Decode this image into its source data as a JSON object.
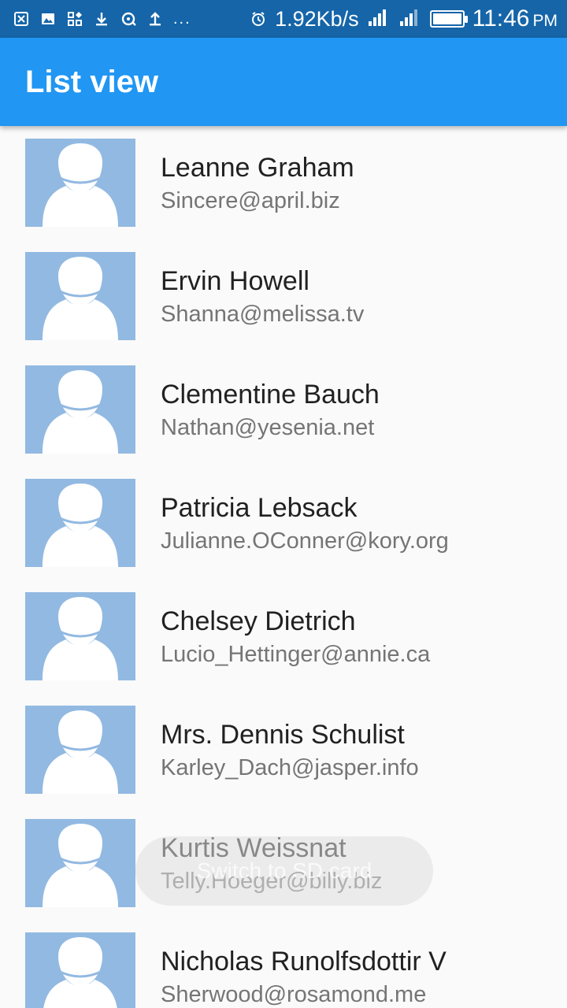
{
  "status_bar": {
    "notification_icons": [
      "close-box-icon",
      "image-icon",
      "apps-icon",
      "download-icon",
      "sync-icon",
      "upload-icon"
    ],
    "more": "...",
    "network_speed": "1.92Kb/s",
    "time": "11:46",
    "ampm": "PM"
  },
  "app_bar": {
    "title": "List view",
    "color": "#2196f3"
  },
  "contacts": [
    {
      "name": "Leanne Graham",
      "email": "Sincere@april.biz"
    },
    {
      "name": "Ervin Howell",
      "email": "Shanna@melissa.tv"
    },
    {
      "name": "Clementine Bauch",
      "email": "Nathan@yesenia.net"
    },
    {
      "name": "Patricia Lebsack",
      "email": "Julianne.OConner@kory.org"
    },
    {
      "name": "Chelsey Dietrich",
      "email": "Lucio_Hettinger@annie.ca"
    },
    {
      "name": "Mrs. Dennis Schulist",
      "email": "Karley_Dach@jasper.info"
    },
    {
      "name": "Kurtis Weissnat",
      "email": "Telly.Hoeger@billy.biz"
    },
    {
      "name": "Nicholas Runolfsdottir V",
      "email": "Sherwood@rosamond.me"
    }
  ],
  "toast": {
    "message": "Switch to SD card"
  }
}
